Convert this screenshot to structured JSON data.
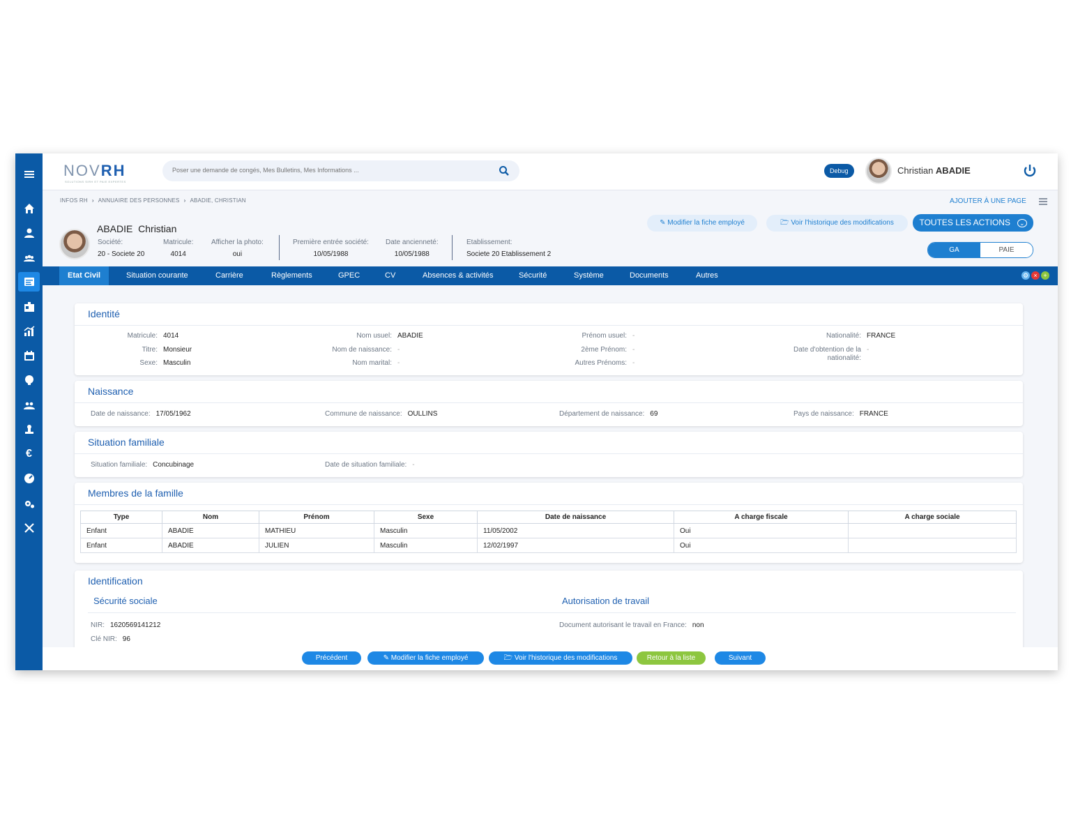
{
  "topbar": {
    "logo_main": "NOV",
    "logo_accent": "RH",
    "logo_tagline": "SOLUTIONS SIRH ET PAIE EXPERTES",
    "search_placeholder": "Poser une demande de congés, Mes Bulletins, Mes Informations ...",
    "debug_label": "Debug",
    "user_first": "Christian",
    "user_last": "ABADIE"
  },
  "breadcrumb": [
    "INFOS RH",
    "ANNUAIRE DES PERSONNES",
    "ABADIE, CHRISTIAN"
  ],
  "add_page_label": "AJOUTER À UNE PAGE",
  "employee": {
    "last_name": "ABADIE",
    "first_name": "Christian",
    "fields": [
      {
        "label": "Société:",
        "value": "20 - Societe 20"
      },
      {
        "label": "Matricule:",
        "value": "4014"
      },
      {
        "label": "Afficher la photo:",
        "value": "oui"
      },
      {
        "label": "Première entrée société:",
        "value": "10/05/1988"
      },
      {
        "label": "Date ancienneté:",
        "value": "10/05/1988"
      },
      {
        "label": "Etablissement:",
        "value": "Societe 20 Etablissement 2"
      }
    ]
  },
  "actions": {
    "edit": "Modifier la fiche employé",
    "history": "Voir l'historique des modifications",
    "all": "TOUTES LES ACTIONS"
  },
  "toggle": {
    "ga": "GA",
    "paie": "PAIE",
    "selected": "GA"
  },
  "tabs": [
    "Etat Civil",
    "Situation courante",
    "Carrière",
    "Règlements",
    "GPEC",
    "CV",
    "Absences & activités",
    "Sécurité",
    "Système",
    "Documents",
    "Autres"
  ],
  "active_tab": "Etat Civil",
  "identite": {
    "title": "Identité",
    "matricule": {
      "label": "Matricule:",
      "value": "4014"
    },
    "titre": {
      "label": "Titre:",
      "value": "Monsieur"
    },
    "sexe": {
      "label": "Sexe:",
      "value": "Masculin"
    },
    "nom_usuel": {
      "label": "Nom usuel:",
      "value": "ABADIE"
    },
    "nom_naissance": {
      "label": "Nom de naissance:",
      "value": "-"
    },
    "nom_marital": {
      "label": "Nom marital:",
      "value": "-"
    },
    "prenom_usuel": {
      "label": "Prénom usuel:",
      "value": "-"
    },
    "prenom_2": {
      "label": "2ème Prénom:",
      "value": "-"
    },
    "autres_prenoms": {
      "label": "Autres Prénoms:",
      "value": "-"
    },
    "nationalite": {
      "label": "Nationalité:",
      "value": "FRANCE"
    },
    "date_nat_1": "Date d'obtention de la",
    "date_nat_2": "nationalité:",
    "date_nat_value": "-"
  },
  "naissance": {
    "title": "Naissance",
    "date": {
      "label": "Date de naissance:",
      "value": "17/05/1962"
    },
    "commune": {
      "label": "Commune de naissance:",
      "value": "OULLINS"
    },
    "departement": {
      "label": "Département de naissance:",
      "value": "69"
    },
    "pays": {
      "label": "Pays de naissance:",
      "value": "FRANCE"
    }
  },
  "situation": {
    "title": "Situation familiale",
    "situation": {
      "label": "Situation familiale:",
      "value": "Concubinage"
    },
    "date": {
      "label": "Date de situation familiale:",
      "value": "-"
    }
  },
  "famille": {
    "title": "Membres de la famille",
    "headers": [
      "Type",
      "Nom",
      "Prénom",
      "Sexe",
      "Date de naissance",
      "A charge fiscale",
      "A charge sociale"
    ],
    "rows": [
      [
        "Enfant",
        "ABADIE",
        "MATHIEU",
        "Masculin",
        "11/05/2002",
        "Oui",
        ""
      ],
      [
        "Enfant",
        "ABADIE",
        "JULIEN",
        "Masculin",
        "12/02/1997",
        "Oui",
        ""
      ]
    ]
  },
  "identification": {
    "title": "Identification",
    "secu_title": "Sécurité sociale",
    "travail_title": "Autorisation de travail",
    "nir": {
      "label": "NIR:",
      "value": "1620569141212"
    },
    "cle_nir": {
      "label": "Clé NIR:",
      "value": "96"
    },
    "doc_travail": {
      "label": "Document autorisant le travail en France:",
      "value": "non"
    }
  },
  "bottom": {
    "prev": "Précédent",
    "edit": "Modifier la fiche employé",
    "history": "Voir l'historique des modifications",
    "back": "Retour à la liste",
    "next": "Suivant"
  },
  "colors": {
    "primary": "#0b5aa6",
    "accent": "#1e7fd0",
    "green": "#8dc63f"
  },
  "sidebar_icons": [
    "menu-icon",
    "home-icon",
    "person-icon",
    "group-icon",
    "id-card-icon",
    "badge-icon",
    "chart-icon",
    "calendar-icon",
    "lightbulb-icon",
    "team-icon",
    "stamp-icon",
    "euro-icon",
    "dashboard-icon",
    "settings-icon",
    "tools-icon"
  ]
}
